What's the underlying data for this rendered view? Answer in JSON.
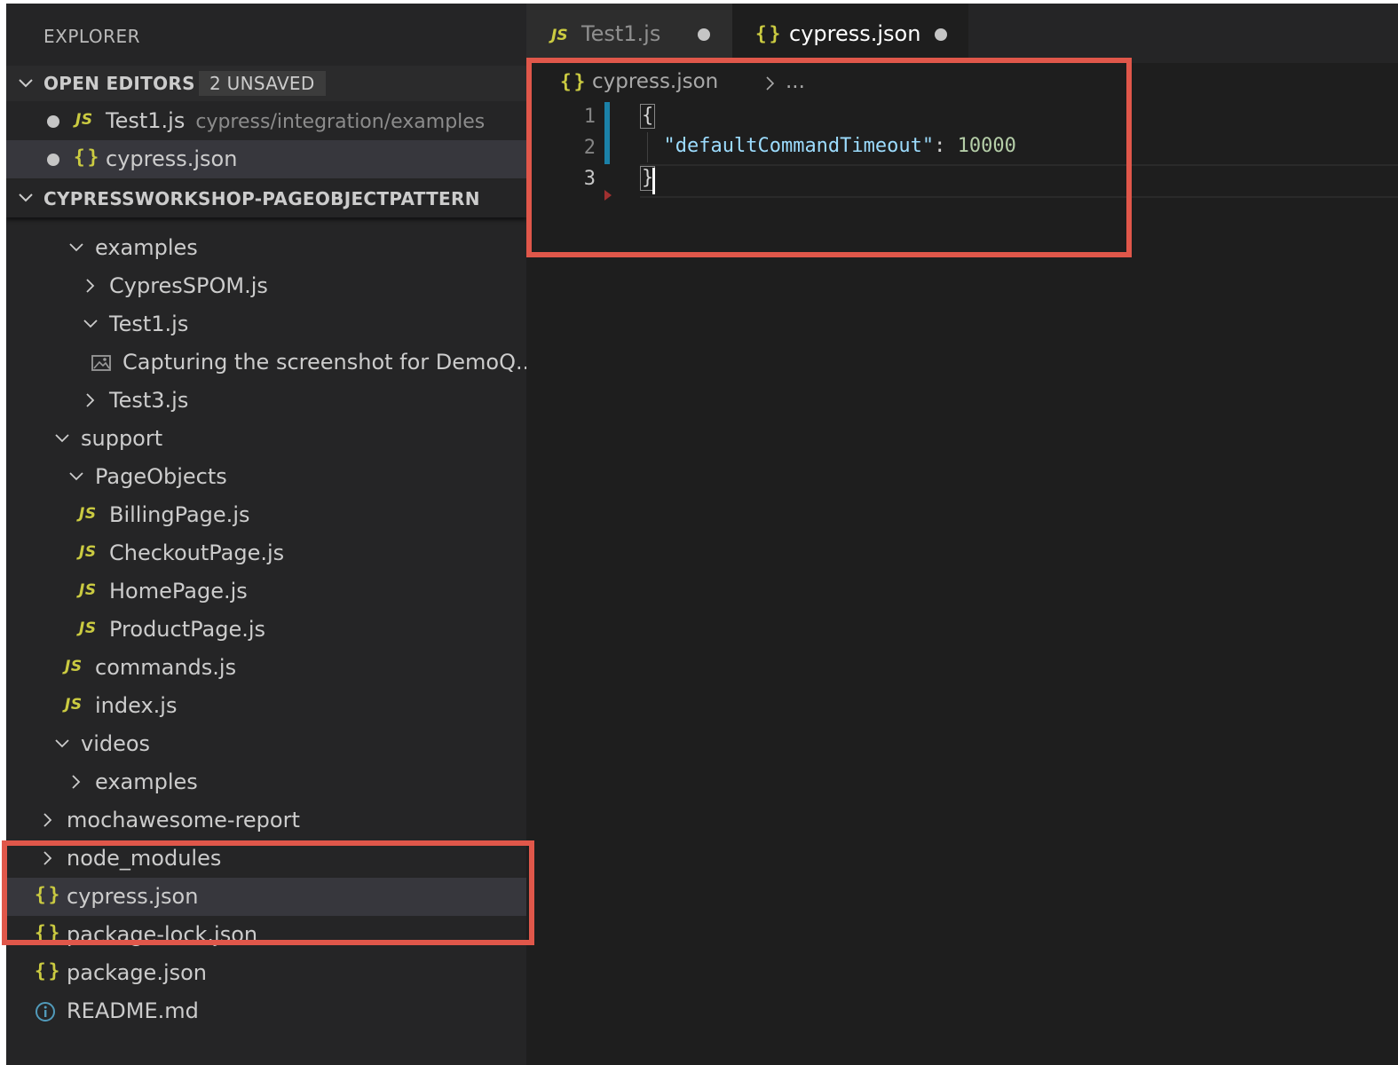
{
  "sidebar": {
    "title": "EXPLORER",
    "open_editors": {
      "title": "OPEN EDITORS",
      "badge": "2 UNSAVED",
      "items": [
        {
          "name": "Test1.js",
          "path": "cypress/integration/examples",
          "icon": "js-icon"
        },
        {
          "name": "cypress.json",
          "path": "",
          "icon": "json-icon"
        }
      ]
    },
    "project": {
      "title": "CYPRESSWORKSHOP-PAGEOBJECTPATTERN",
      "tree": [
        {
          "label": "examples",
          "kind": "folder-open"
        },
        {
          "label": "CypresSPOM.js",
          "kind": "folder-closed"
        },
        {
          "label": "Test1.js",
          "kind": "folder-open"
        },
        {
          "label": "Capturing the screenshot for DemoQ...",
          "kind": "image"
        },
        {
          "label": "Test3.js",
          "kind": "folder-closed"
        },
        {
          "label": "support",
          "kind": "folder-open"
        },
        {
          "label": "PageObjects",
          "kind": "folder-open"
        },
        {
          "label": "BillingPage.js",
          "kind": "js"
        },
        {
          "label": "CheckoutPage.js",
          "kind": "js"
        },
        {
          "label": "HomePage.js",
          "kind": "js"
        },
        {
          "label": "ProductPage.js",
          "kind": "js"
        },
        {
          "label": "commands.js",
          "kind": "js"
        },
        {
          "label": "index.js",
          "kind": "js"
        },
        {
          "label": "videos",
          "kind": "folder-open"
        },
        {
          "label": "examples",
          "kind": "folder-closed"
        },
        {
          "label": "mochawesome-report",
          "kind": "folder-closed"
        },
        {
          "label": "node_modules",
          "kind": "folder-closed"
        },
        {
          "label": "cypress.json",
          "kind": "json"
        },
        {
          "label": "package-lock.json",
          "kind": "json"
        },
        {
          "label": "package.json",
          "kind": "json"
        },
        {
          "label": "README.md",
          "kind": "info"
        }
      ]
    }
  },
  "icons": {
    "js": "JS",
    "json": "{}"
  },
  "tabs": [
    {
      "label": "Test1.js",
      "icon": "js-icon",
      "state": "inactive",
      "modified": true
    },
    {
      "label": "cypress.json",
      "icon": "json-icon",
      "state": "active",
      "modified": true
    }
  ],
  "editor": {
    "breadcrumb": {
      "file": "cypress.json",
      "more": "..."
    },
    "line_numbers": [
      "1",
      "2",
      "3"
    ],
    "lines": {
      "open_brace": "{",
      "key": "\"defaultCommandTimeout\"",
      "colon": ": ",
      "value": "10000",
      "close_brace": "}"
    }
  },
  "colors": {
    "highlight_box": "#e0574a",
    "json_icon": "#cbcb41",
    "sidebar_bg": "#252526",
    "editor_bg": "#1e1e1e"
  }
}
